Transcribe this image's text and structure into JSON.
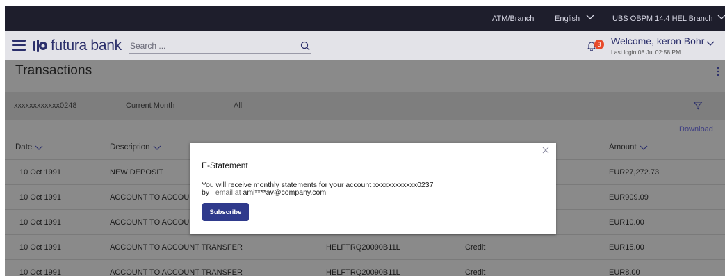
{
  "topbar": {
    "atm_branch": "ATM/Branch",
    "language": "English",
    "branch": "UBS OBPM 14.4 HEL Branch"
  },
  "header": {
    "logo_text": "futura bank",
    "search_placeholder": "Search ...",
    "notification_count": "3",
    "welcome": "Welcome, keron Bohr",
    "last_login": "Last login 08 Jul 02:58 PM"
  },
  "page": {
    "title": "Transactions"
  },
  "filters": {
    "account": "xxxxxxxxxxxx0248",
    "period": "Current Month",
    "type": "All"
  },
  "download_label": "Download",
  "table": {
    "headers": {
      "date": "Date",
      "description": "Description",
      "amount": "Amount"
    },
    "rows": [
      {
        "date": "10 Oct 1991",
        "description": "NEW DEPOSIT",
        "reference": "",
        "type": "",
        "amount": "EUR27,272.73"
      },
      {
        "date": "10 Oct 1991",
        "description": "ACCOUNT TO ACCOU",
        "reference": "",
        "type": "",
        "amount": "EUR909.09"
      },
      {
        "date": "10 Oct 1991",
        "description": "ACCOUNT TO ACCOU",
        "reference": "",
        "type": "",
        "amount": "EUR10.00"
      },
      {
        "date": "10 Oct 1991",
        "description": "ACCOUNT TO ACCOUNT TRANSFER",
        "reference": "HELFTRQ20090B11L",
        "type": "Credit",
        "amount": "EUR15.00"
      },
      {
        "date": "10 Oct 1991",
        "description": "ACCOUNT TO ACCOUNT TRANSFER",
        "reference": "HELFTRQ20090B11L",
        "type": "Credit",
        "amount": "EUR8.00"
      }
    ]
  },
  "modal": {
    "title": "E-Statement",
    "message_line1": "You will receive monthly statements for your account xxxxxxxxxxxx0237",
    "message_by": "by",
    "message_email_prefix": "email at",
    "message_email": "ami****av@company.com",
    "subscribe_label": "Subscribe"
  },
  "colors": {
    "brand": "#2b2f6b",
    "button": "#2f3a8c",
    "badge": "#e84a2a",
    "topbar": "#1e1e2c"
  }
}
